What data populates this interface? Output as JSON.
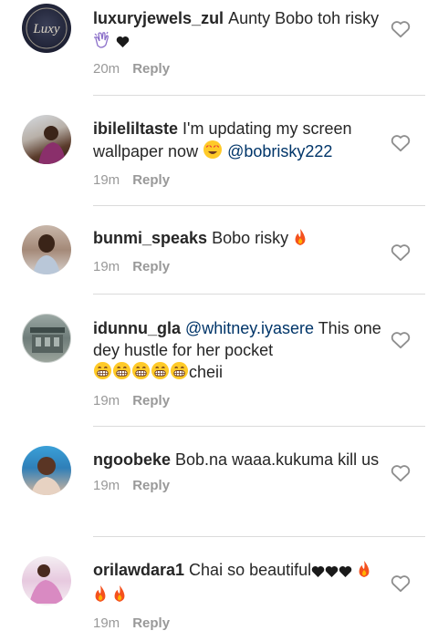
{
  "comments": [
    {
      "username": "luxuryjewels_zul",
      "text": "Aunty Bobo toh risky",
      "emojis": [
        "clapping-hands",
        "black-heart"
      ],
      "time": "20m",
      "reply": "Reply"
    },
    {
      "username": "ibileliltaste",
      "text": "I'm updating my screen wallpaper now",
      "emojis": [
        "heart-eyes"
      ],
      "mention": "@bobrisky222",
      "time": "19m",
      "reply": "Reply"
    },
    {
      "username": "bunmi_speaks",
      "text": "Bobo risky",
      "emojis": [
        "fire"
      ],
      "time": "19m",
      "reply": "Reply"
    },
    {
      "username": "idunnu_gla",
      "mention": "@whitney.iyasere",
      "text": "This one dey hustle for  her pocket",
      "emojis": [
        "grin",
        "grin",
        "grin",
        "grin",
        "grin"
      ],
      "tail": "cheii",
      "time": "19m",
      "reply": "Reply"
    },
    {
      "username": "ngoobeke",
      "text": "Bob.na waaa.kukuma kill us",
      "time": "19m",
      "reply": "Reply"
    },
    {
      "username": "orilawdara1",
      "text": "Chai so beautiful",
      "emojis": [
        "black-heart",
        "black-heart",
        "black-heart",
        "fire",
        "fire",
        "fire"
      ],
      "time": "19m",
      "reply": "Reply"
    }
  ],
  "colors": {
    "text": "#262626",
    "meta": "#999999",
    "mention": "#003569",
    "divider": "#dbdbdb"
  }
}
